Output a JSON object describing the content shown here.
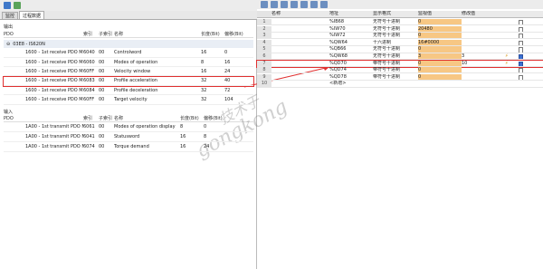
{
  "left": {
    "tabs": [
      "监控",
      "过程数据"
    ],
    "output_label": "输出",
    "input_label": "输入",
    "columns": [
      "PDO",
      "索引",
      "子索引",
      "名称",
      "长度(Bit)",
      "偏移(Bit)"
    ],
    "output_group": "03E8 - IS620N",
    "output_rows": [
      [
        "1600 - 1st receive PDO Mapping",
        "6040",
        "00",
        "Controlword",
        "16",
        "0"
      ],
      [
        "1600 - 1st receive PDO Mapping",
        "6060",
        "00",
        "Modes of operation",
        "8",
        "16"
      ],
      [
        "1600 - 1st receive PDO Mapping",
        "60FF",
        "00",
        "Velocity window",
        "16",
        "24"
      ],
      [
        "1600 - 1st receive PDO Mapping",
        "6083",
        "00",
        "Profile acceleration",
        "32",
        "40"
      ],
      [
        "1600 - 1st receive PDO Mapping",
        "6084",
        "00",
        "Profile deceleration",
        "32",
        "72"
      ],
      [
        "1600 - 1st receive PDO Mapping",
        "60FF",
        "00",
        "Target velocity",
        "32",
        "104"
      ]
    ],
    "input_rows": [
      [
        "1A00 - 1st transmit PDO Mapping",
        "6061",
        "00",
        "Modes of operation display",
        "8",
        "0"
      ],
      [
        "1A00 - 1st transmit PDO Mapping",
        "6041",
        "00",
        "Statusword",
        "16",
        "8"
      ],
      [
        "1A00 - 1st transmit PDO Mapping",
        "6074",
        "00",
        "Torque demand",
        "16",
        "24"
      ]
    ]
  },
  "right": {
    "columns": [
      "",
      "名称",
      "地址",
      "显示格式",
      "监视值",
      "修改值",
      "",
      ""
    ],
    "rows": [
      {
        "n": "1",
        "addr": "%IB68",
        "fmt": "无符号十进制",
        "mon": "0",
        "mod": "",
        "cb": false
      },
      {
        "n": "2",
        "addr": "%IW70",
        "fmt": "无符号十进制",
        "mon": "20480",
        "mod": "",
        "cb": false
      },
      {
        "n": "3",
        "addr": "%IW72",
        "fmt": "无符号十进制",
        "mon": "0",
        "mod": "",
        "cb": false
      },
      {
        "n": "4",
        "addr": "%QW64",
        "fmt": "十六进制",
        "mon": "16#0000",
        "mod": "",
        "cb": false
      },
      {
        "n": "5",
        "addr": "%QB66",
        "fmt": "无符号十进制",
        "mon": "0",
        "mod": "",
        "cb": false
      },
      {
        "n": "6",
        "addr": "%QW68",
        "fmt": "无符号十进制",
        "mon": "3",
        "mod": "3",
        "cb": true
      },
      {
        "n": "7",
        "addr": "%QD70",
        "fmt": "带符号十进制",
        "mon": "0",
        "mod": "10",
        "cb": true
      },
      {
        "n": "8",
        "addr": "%QD74",
        "fmt": "带符号十进制",
        "mon": "0",
        "mod": "",
        "cb": false
      },
      {
        "n": "9",
        "addr": "%QD78",
        "fmt": "带符号十进制",
        "mon": "0",
        "mod": "",
        "cb": false
      },
      {
        "n": "10",
        "addr": "<新增>",
        "fmt": "",
        "mon": "",
        "mod": "",
        "cb": false
      }
    ]
  },
  "watermark": "gongkong",
  "watermark_cn": "技术于"
}
